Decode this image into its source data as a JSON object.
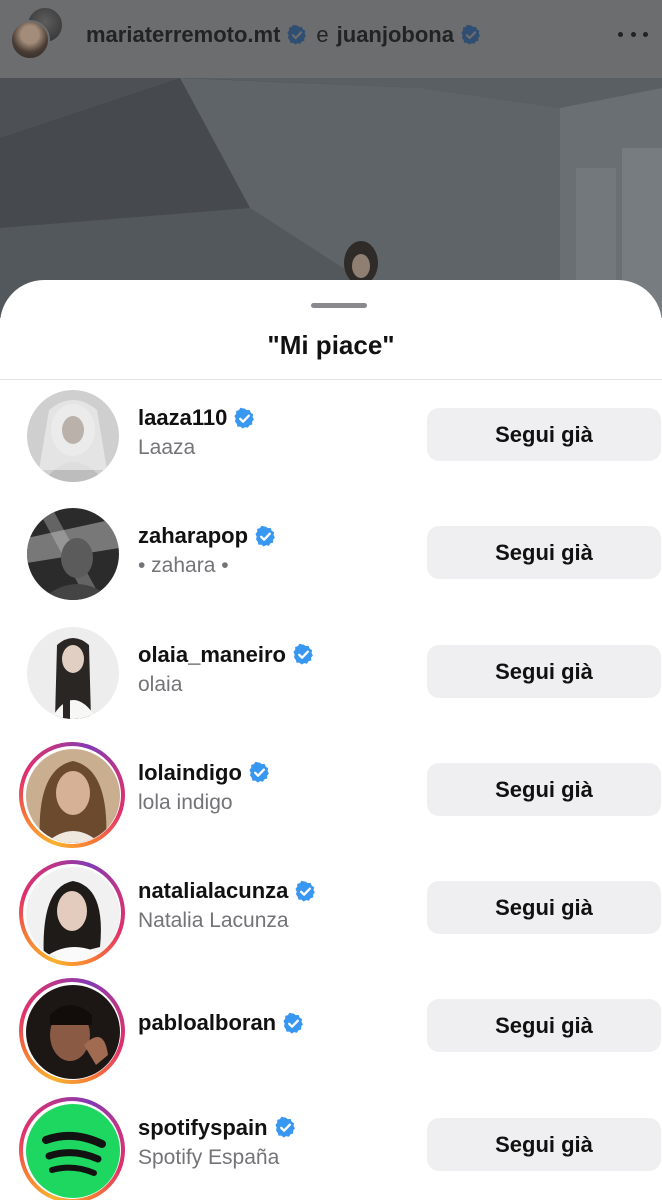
{
  "post": {
    "author_1": "mariaterremoto.mt",
    "conjunction": "e",
    "author_2": "juanjobona",
    "menu_icon": "more-horizontal-icon"
  },
  "sheet": {
    "title": "\"Mi piace\""
  },
  "users": [
    {
      "username": "laaza110",
      "full_name": "Laaza",
      "verified": true,
      "story_ring": false,
      "button": "Segui già"
    },
    {
      "username": "zaharapop",
      "full_name": "• zahara •",
      "verified": true,
      "story_ring": false,
      "button": "Segui già"
    },
    {
      "username": "olaia_maneiro",
      "full_name": "olaia",
      "verified": true,
      "story_ring": false,
      "button": "Segui già"
    },
    {
      "username": "lolaindigo",
      "full_name": "lola indigo",
      "verified": true,
      "story_ring": true,
      "button": "Segui già"
    },
    {
      "username": "natalialacunza",
      "full_name": "Natalia Lacunza",
      "verified": true,
      "story_ring": true,
      "button": "Segui già"
    },
    {
      "username": "pabloalboran",
      "full_name": "",
      "verified": true,
      "story_ring": true,
      "button": "Segui già"
    },
    {
      "username": "spotifyspain",
      "full_name": "Spotify España",
      "verified": true,
      "story_ring": true,
      "button": "Segui già"
    }
  ],
  "colors": {
    "verified_badge": "#3897f0",
    "button_bg": "#efeff1",
    "secondary_text": "#737378",
    "spotify_green": "#1ed760"
  }
}
